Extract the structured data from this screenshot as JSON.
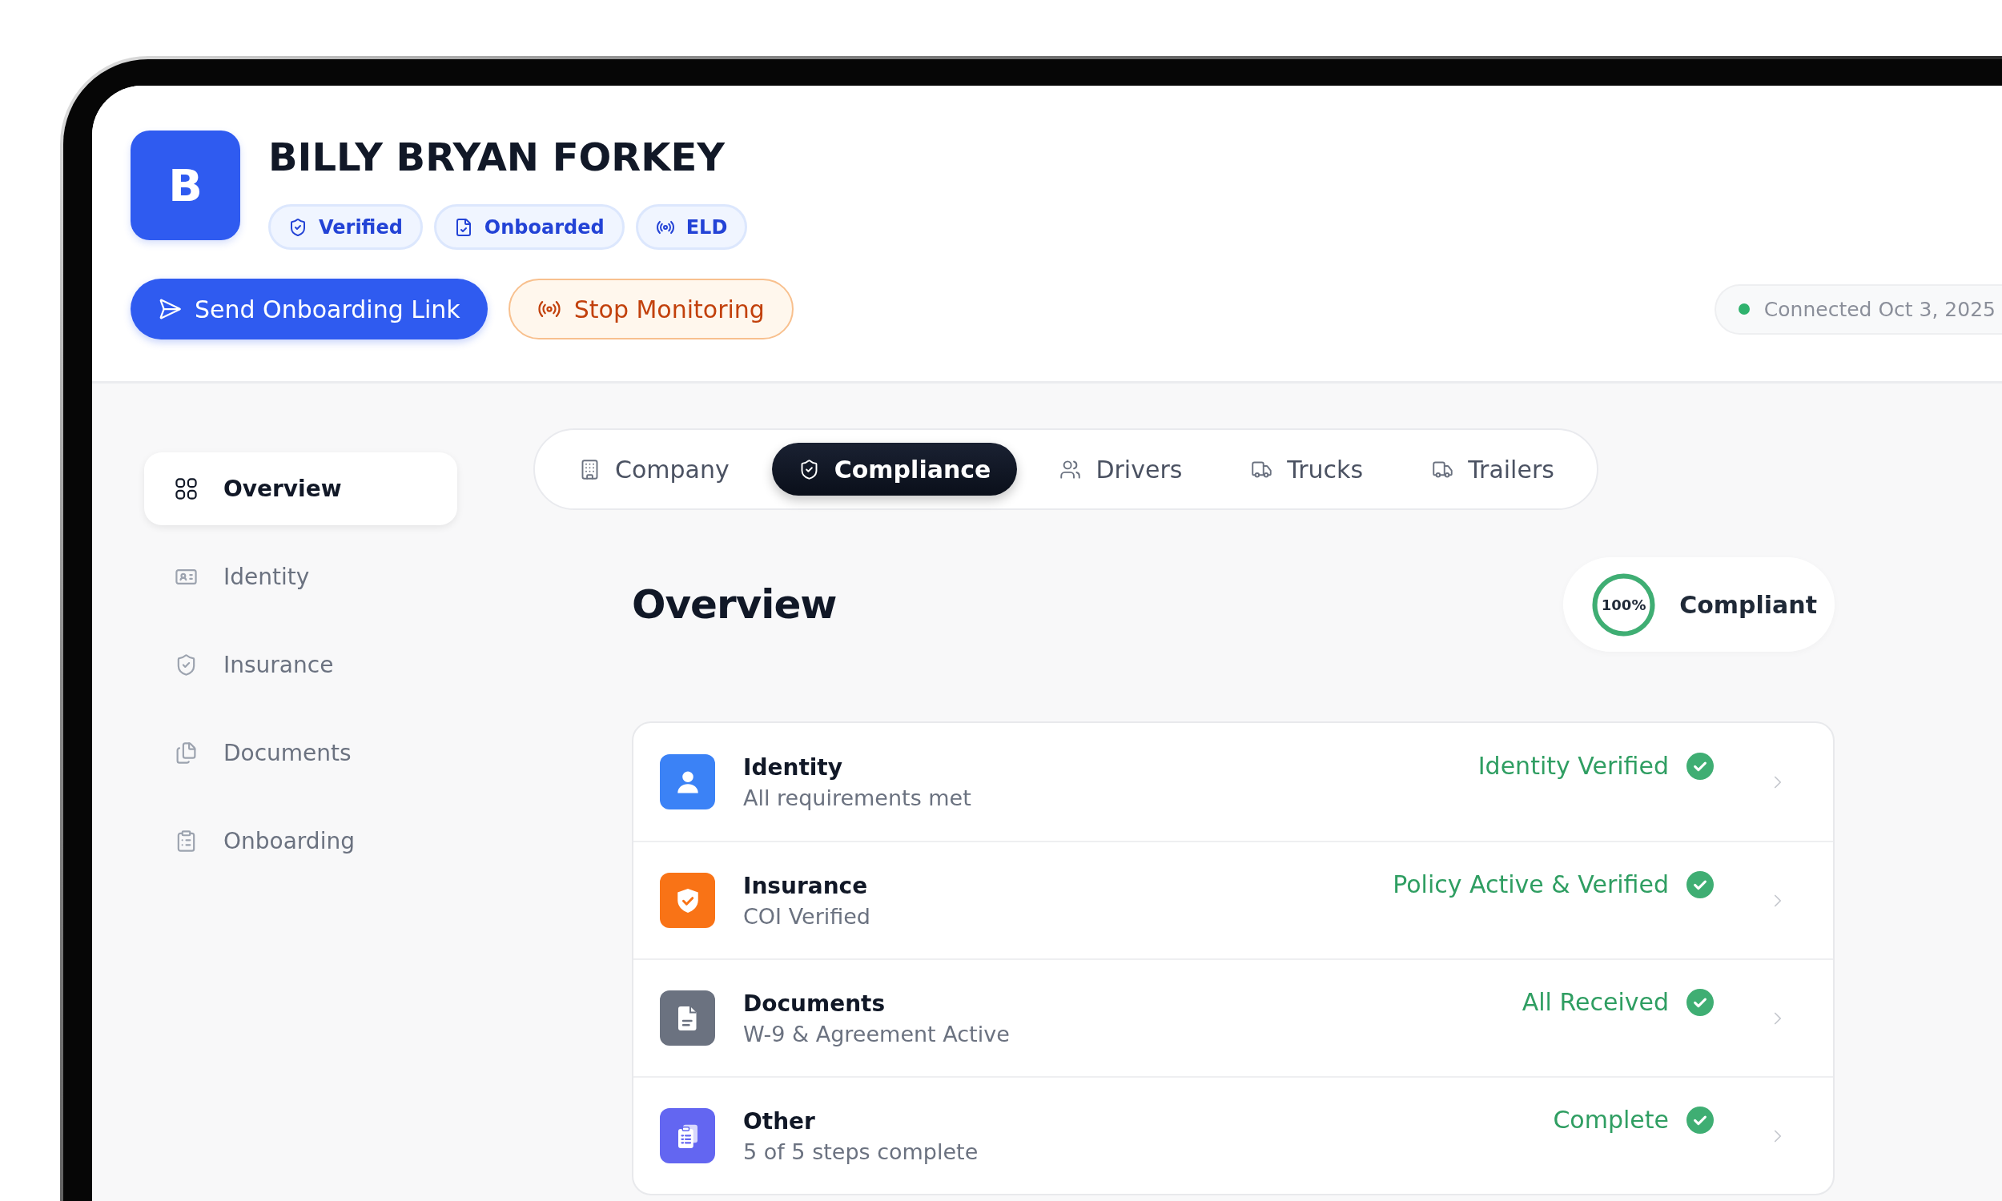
{
  "profile": {
    "initial": "B",
    "name": "BILLY BRYAN FORKEY",
    "badges": [
      "Verified",
      "Onboarded",
      "ELD"
    ]
  },
  "actions": [
    {
      "label": "Send Onboarding Link",
      "kind": "primary"
    },
    {
      "label": "Stop Monitoring",
      "kind": "warning"
    }
  ],
  "connection": {
    "label": "Connected Oct 3, 2025",
    "connected": true
  },
  "sidebar": {
    "items": [
      {
        "label": "Overview",
        "selected": true
      },
      {
        "label": "Identity",
        "selected": false
      },
      {
        "label": "Insurance",
        "selected": false
      },
      {
        "label": "Documents",
        "selected": false
      },
      {
        "label": "Onboarding",
        "selected": false
      }
    ]
  },
  "tabs": [
    {
      "label": "Company",
      "selected": false
    },
    {
      "label": "Compliance",
      "selected": true
    },
    {
      "label": "Drivers",
      "selected": false
    },
    {
      "label": "Trucks",
      "selected": false
    },
    {
      "label": "Trailers",
      "selected": false
    }
  ],
  "overview": {
    "title": "Overview",
    "compliance": {
      "percent": "100%",
      "level": 1,
      "label": "Compliant"
    },
    "rows": [
      {
        "title": "Identity",
        "subtitle": "All requirements met",
        "status": "Identity Verified",
        "complete": true,
        "color": "#3b82f6"
      },
      {
        "title": "Insurance",
        "subtitle": "COI Verified",
        "status": "Policy Active & Verified",
        "complete": true,
        "color": "#f97316"
      },
      {
        "title": "Documents",
        "subtitle": "W-9 & Agreement Active",
        "status": "All Received",
        "complete": true,
        "color": "#6b7280"
      },
      {
        "title": "Other",
        "subtitle": "5 of 5 steps complete",
        "status": "Complete",
        "complete": true,
        "color": "#6366f1"
      }
    ]
  }
}
